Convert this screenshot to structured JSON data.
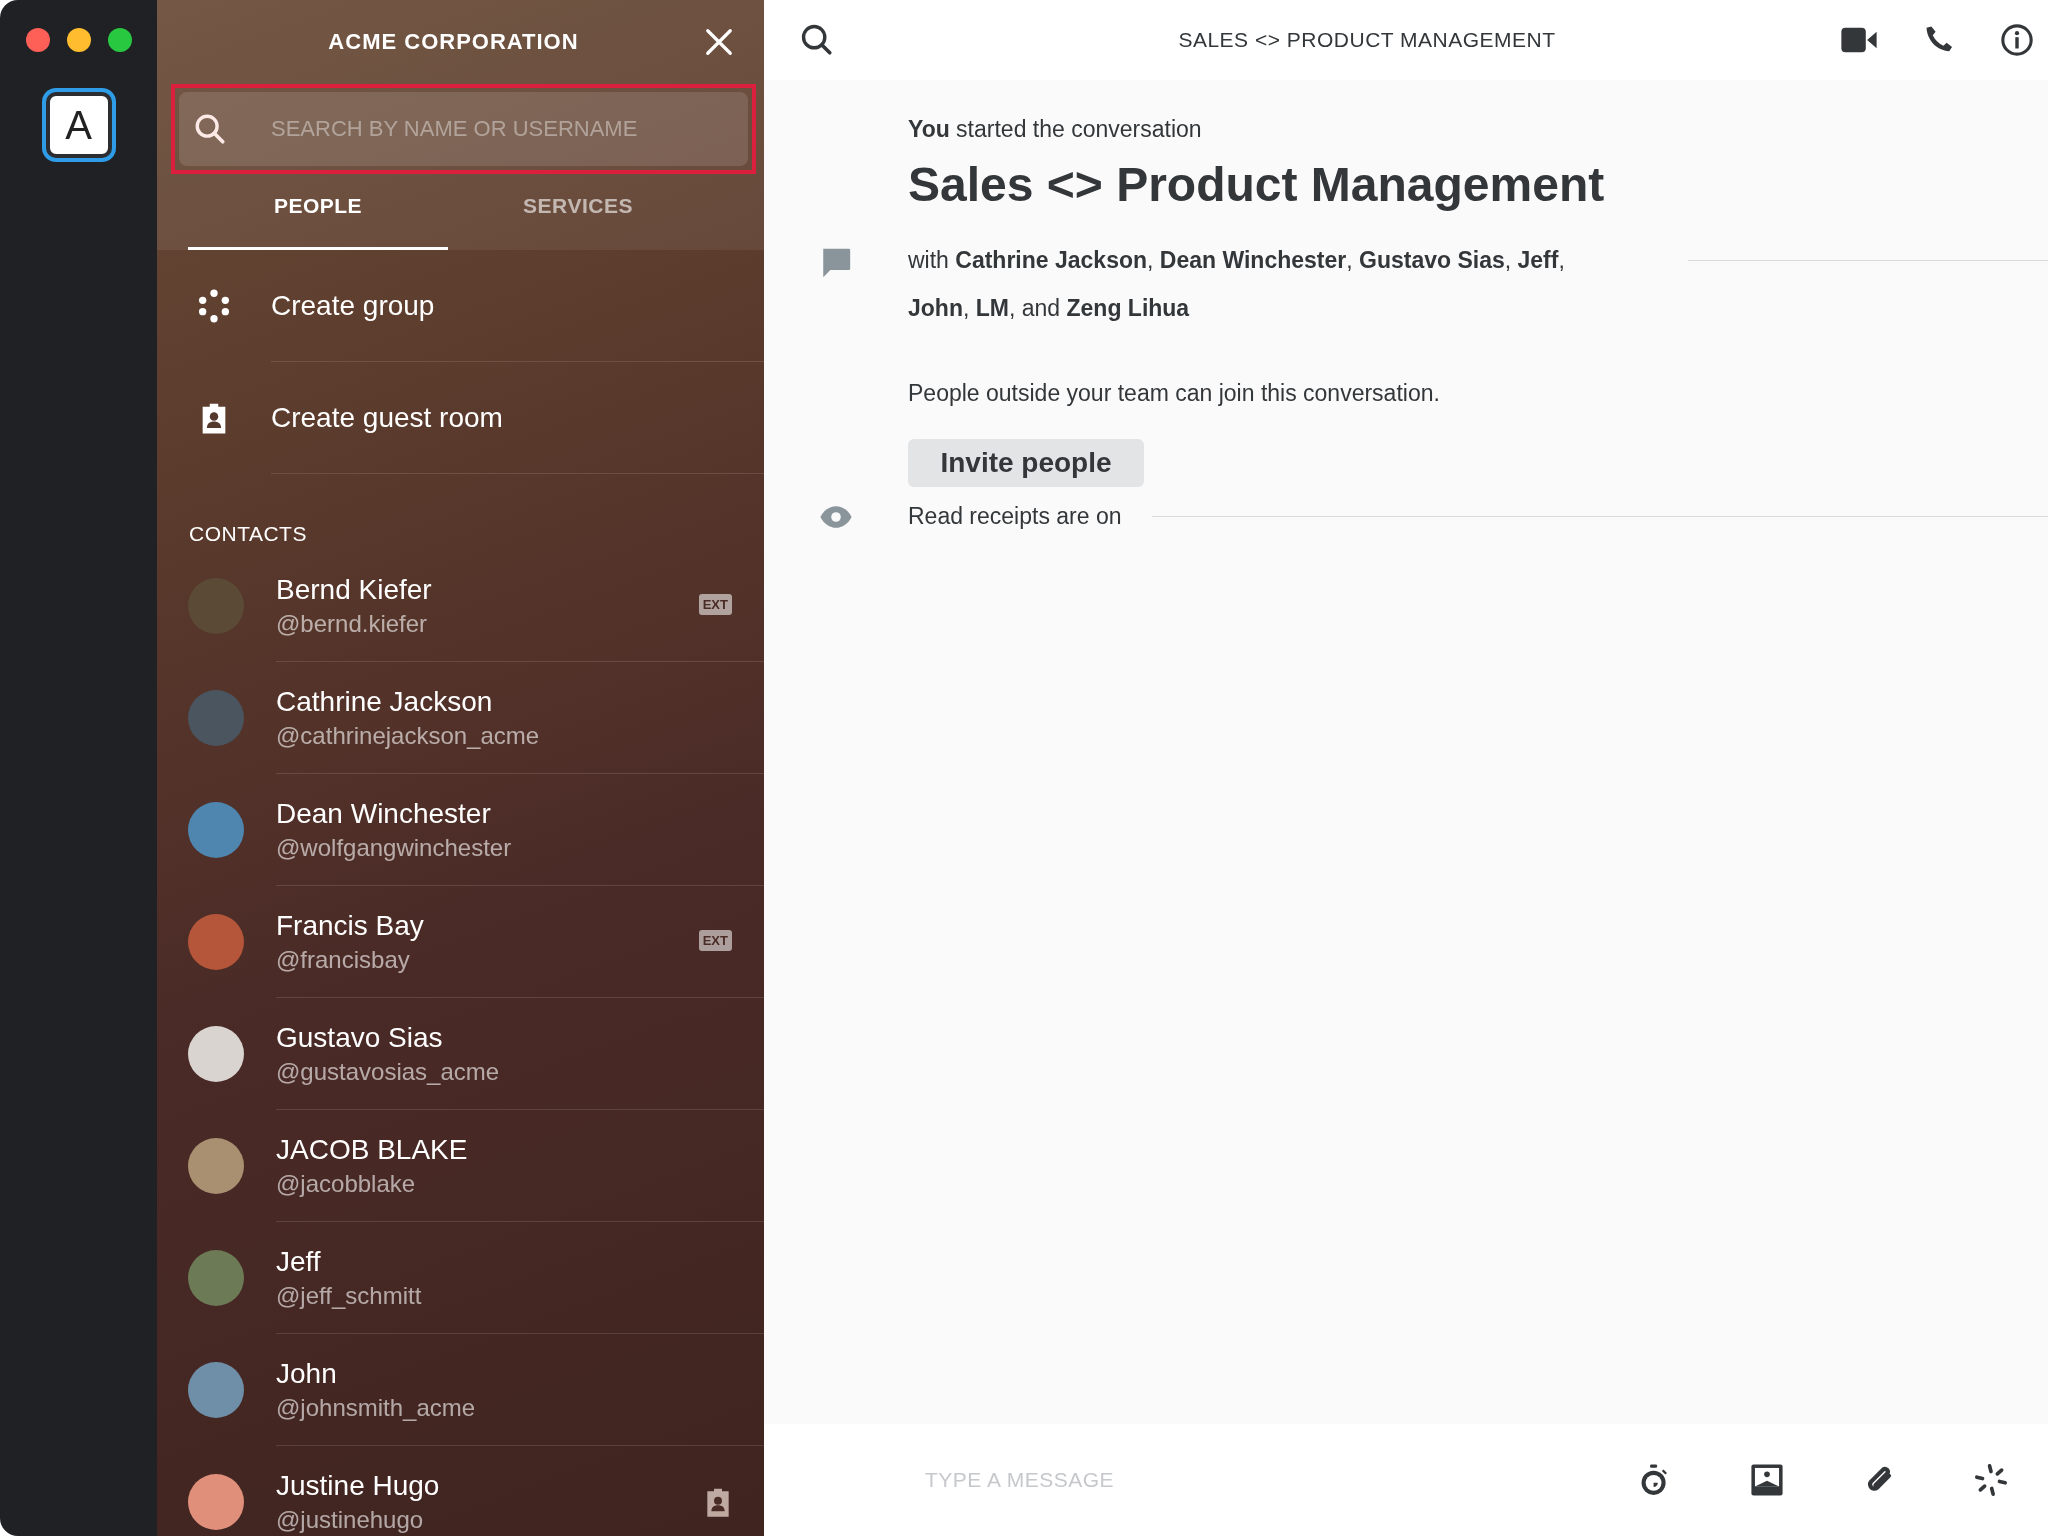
{
  "account": {
    "letter": "A",
    "selected": true
  },
  "sidebar": {
    "title": "ACME CORPORATION",
    "search": {
      "placeholder": "SEARCH BY NAME OR USERNAME",
      "highlighted": true
    },
    "tabs": [
      {
        "label": "PEOPLE",
        "selected": true
      },
      {
        "label": "SERVICES",
        "selected": false
      }
    ],
    "actions": [
      {
        "kind": "group",
        "label": "Create group"
      },
      {
        "kind": "guest",
        "label": "Create guest room"
      }
    ],
    "contacts_heading": "CONTACTS",
    "contacts": [
      {
        "name": "Bernd Kiefer",
        "handle": "@bernd.kiefer",
        "badge": "EXT"
      },
      {
        "name": "Cathrine Jackson",
        "handle": "@cathrinejackson_acme"
      },
      {
        "name": "Dean Winchester",
        "handle": "@wolfgangwinchester"
      },
      {
        "name": "Francis Bay",
        "handle": "@francisbay",
        "badge": "EXT"
      },
      {
        "name": "Gustavo Sias",
        "handle": "@gustavosias_acme"
      },
      {
        "name": "JACOB BLAKE",
        "handle": "@jacobblake"
      },
      {
        "name": "Jeff",
        "handle": "@jeff_schmitt"
      },
      {
        "name": "John",
        "handle": "@johnsmith_acme"
      },
      {
        "name": "Justine Hugo",
        "handle": "@justinehugo",
        "guest": true
      }
    ]
  },
  "conversation": {
    "title": "SALES <> PRODUCT MANAGEMENT",
    "started": "**You** started the conversation",
    "heading": "Sales <> Product Management",
    "participants": "with **Cathrine Jackson**, **Dean Winchester**, **Gustavo Sias**, **Jeff**, **John**, **LM**, and **Zeng Lihua**",
    "guest_note": "People outside your team can join this conversation.",
    "invite_button": "Invite people",
    "receipts": "Read receipts are on",
    "composer": {
      "placeholder": "TYPE A MESSAGE"
    }
  }
}
